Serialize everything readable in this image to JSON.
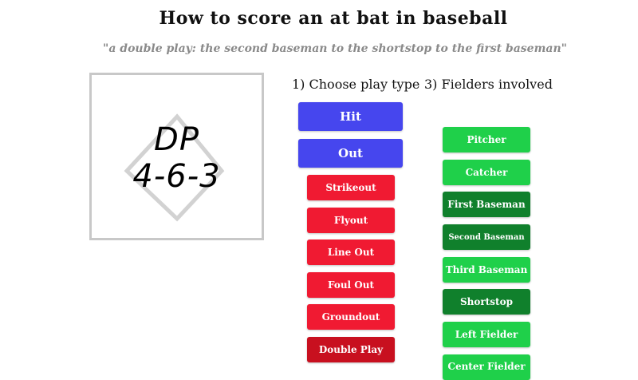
{
  "header": {
    "title": "How to score an at bat in baseball",
    "subtitle": "\"a double play: the second baseman to the shortstop to the first baseman\""
  },
  "scorecard": {
    "notation_line1": "DP",
    "notation_line2": "4-6-3"
  },
  "play_type": {
    "heading": "1) Choose play type",
    "options": [
      "Hit",
      "Out"
    ]
  },
  "outs": {
    "options": [
      "Strikeout",
      "Flyout",
      "Line Out",
      "Foul Out",
      "Groundout",
      "Double Play"
    ],
    "selected": "Double Play"
  },
  "fielders": {
    "heading": "3) Fielders involved",
    "options": [
      "Pitcher",
      "Catcher",
      "First Baseman",
      "Second Baseman",
      "Third Baseman",
      "Shortstop",
      "Left Fielder",
      "Center Fielder"
    ],
    "selected": [
      "First Baseman",
      "Second Baseman",
      "Shortstop"
    ]
  },
  "colors": {
    "play_type_button": "#4646ee",
    "out_button": "#f01a32",
    "out_button_selected": "#c8101f",
    "fielder_button": "#1fd04a",
    "fielder_button_selected": "#10802c"
  }
}
